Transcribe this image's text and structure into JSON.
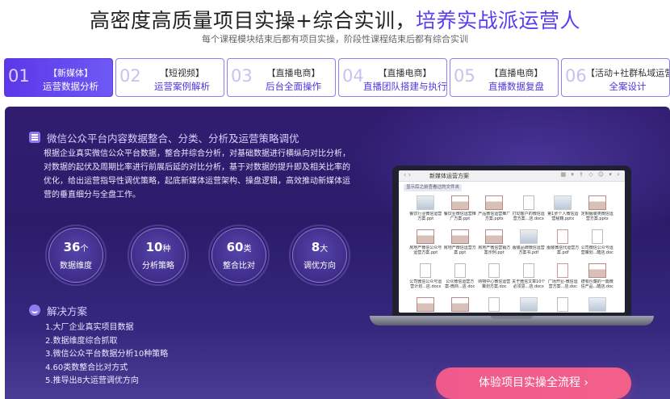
{
  "headline": {
    "main": "高密度高质量项目实操+综合实训，",
    "accent": "培养实战派运营人"
  },
  "subline": "每个课程模块结束后都有项目实操，阶段性课程结束后都有综合实训",
  "tabs": [
    {
      "num": "01",
      "top": "【新媒体】",
      "bottom": "运营数据分析"
    },
    {
      "num": "02",
      "top": "【短视频】",
      "bottom": "运营案例解析"
    },
    {
      "num": "03",
      "top": "【直播电商】",
      "bottom": "后台全面操作"
    },
    {
      "num": "04",
      "top": "【直播电商】",
      "bottom": "直播团队搭建与执行"
    },
    {
      "num": "05",
      "top": "【直播电商】",
      "bottom": "直播数据复盘"
    },
    {
      "num": "06",
      "top": "【活动+社群私域运营】",
      "bottom": "全案设计"
    }
  ],
  "section": {
    "title": "微信公众平台内容数据整合、分类、分析及运营策略调优",
    "lines": [
      "根据企业真实微信公众平台数据，整合并综合分析，对基础数据进行横纵向对比分析，",
      "对数据的起伏及周期比率进行前展后延的对比分析，基于对数据的提升即及相关比率的",
      "优化，给出运营指导性调优策略，起底新媒体运营架构、操盘逻辑，高效推动新媒体运",
      "营的垂直细分与全盘工作。"
    ]
  },
  "stats": [
    {
      "num": "36",
      "unit": "个",
      "label": "数据维度"
    },
    {
      "num": "10",
      "unit": "种",
      "label": "分析策略"
    },
    {
      "num": "60",
      "unit": "类",
      "label": "整合比对"
    },
    {
      "num": "8",
      "unit": "大",
      "label": "调优方向"
    }
  ],
  "solution": {
    "title": "解决方案",
    "items": [
      "1.大厂企业真实项目数据",
      "2.数据维度综合抓取",
      "3.微信公众平台数据分析10种策略",
      "4.60类数整合比对方式",
      "5.推导出8大运营调优方向"
    ]
  },
  "window": {
    "nav": "‹ ›",
    "title": "新媒体运营方案",
    "tools": "▦ ▾ ⇪ ◇ ☺ ▾ ⌕",
    "path": "显示后之前查看过的文件夹"
  },
  "files": [
    {
      "type": "img",
      "name": "餐饮行业微信运营",
      "name2": "方案.ppt"
    },
    {
      "type": "ppt",
      "name": "餐饮业微信运营推",
      "name2": "广方案.ppt"
    },
    {
      "type": "ppt",
      "name": "产品微信运营推广",
      "name2": "方案.pptx"
    },
    {
      "type": "doc",
      "name": "打动客户的微信运",
      "name2": "营方案...店.docx"
    },
    {
      "type": "img",
      "name": "第1步个人微信运",
      "name2": "营秘籍.pptx"
    },
    {
      "type": "ppt",
      "name": "定制服装类微信运",
      "name2": "营方案.pptx"
    },
    {
      "type": "ppt",
      "name": "房地产微信公众号",
      "name2": "运营方案.ppt"
    },
    {
      "type": "ppt",
      "name": "房地产微信运营方",
      "name2": "案.ppt"
    },
    {
      "type": "ppt",
      "name": "房地产微信营销方",
      "name2": "案示例.ppt"
    },
    {
      "type": "img",
      "name": "服装品牌微信运营",
      "name2": "方案书.pdf"
    },
    {
      "type": "pdf",
      "name": "服装微信代运营方",
      "name2": "案.pdf"
    },
    {
      "type": "doc",
      "name": "公司微信公众号运",
      "name2": "营策划...酷店.doc"
    },
    {
      "type": "doc",
      "name": "公司微信公众号运",
      "name2": "营计划...店.docx"
    },
    {
      "type": "doc",
      "name": "公众微信运营方",
      "name2": "案-微商...店.doc"
    },
    {
      "type": "doc",
      "name": "购物中心微信运营",
      "name2": "策划方案.doc"
    },
    {
      "type": "doc",
      "name": "关于微信文章10个",
      "name2": "必须思...店.docx"
    },
    {
      "type": "pdf",
      "name": "广场开业-微信运",
      "name2": "营方案...店.doc"
    },
    {
      "type": "ppt",
      "name": "德有价廉的一篇微",
      "name2": "信产品...酷店.doc"
    },
    {
      "type": "ppt",
      "name": "",
      "name2": ""
    },
    {
      "type": "ppt",
      "name": "",
      "name2": ""
    },
    {
      "type": "doc",
      "name": "",
      "name2": ""
    },
    {
      "type": "img",
      "name": "",
      "name2": ""
    },
    {
      "type": "doc",
      "name": "",
      "name2": ""
    },
    {
      "type": "img",
      "name": "",
      "name2": ""
    }
  ],
  "cta": "体验项目实操全流程 ›"
}
